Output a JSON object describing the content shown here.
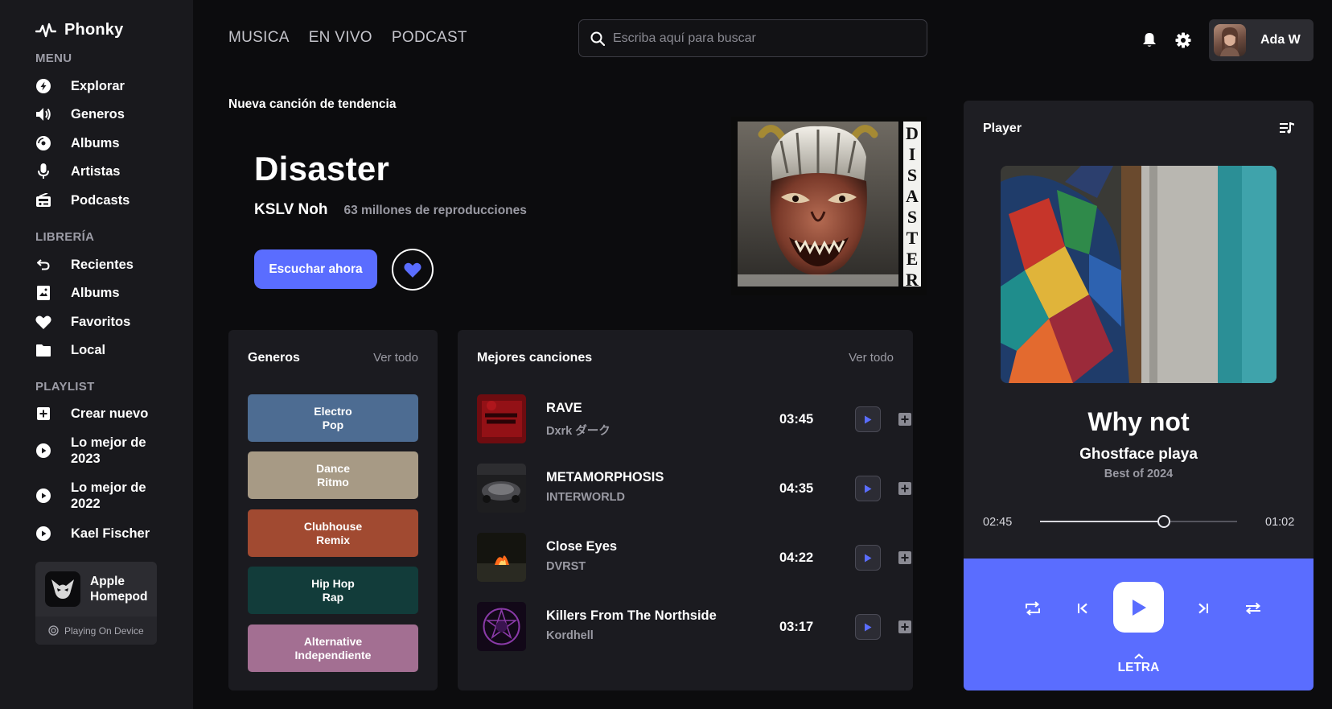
{
  "app": {
    "name": "Phonky"
  },
  "sidebar": {
    "menu_label": "MENU",
    "menu": [
      {
        "label": "Explorar",
        "icon": "compass-icon"
      },
      {
        "label": "Generos",
        "icon": "speaker-icon"
      },
      {
        "label": "Albums",
        "icon": "disc-icon"
      },
      {
        "label": "Artistas",
        "icon": "microphone-icon"
      },
      {
        "label": "Podcasts",
        "icon": "radio-icon"
      }
    ],
    "library_label": "LIBRERÍA",
    "library": [
      {
        "label": "Recientes",
        "icon": "history-icon"
      },
      {
        "label": "Albums",
        "icon": "album-icon"
      },
      {
        "label": "Favoritos",
        "icon": "heart-icon"
      },
      {
        "label": "Local",
        "icon": "folder-icon"
      }
    ],
    "playlist_label": "PLAYLIST",
    "playlist": [
      {
        "label": "Crear nuevo",
        "icon": "plus-square-icon"
      },
      {
        "label": "Lo mejor de 2023",
        "icon": "play-circle-icon"
      },
      {
        "label": "Lo mejor de 2022",
        "icon": "play-circle-icon"
      },
      {
        "label": "Kael Fischer",
        "icon": "play-circle-icon"
      }
    ],
    "device": {
      "name": "Apple Homepod",
      "status": "Playing On Device"
    }
  },
  "topnav": {
    "tabs": [
      "MUSICA",
      "EN VIVO",
      "PODCAST"
    ]
  },
  "search": {
    "placeholder": "Escriba aquí para buscar",
    "value": ""
  },
  "user": {
    "name": "Ada W"
  },
  "hero": {
    "label": "Nueva canción de tendencia",
    "title": "Disaster",
    "artist": "KSLV Noh",
    "plays": "63 millones de reproducciones",
    "cta": "Escuchar ahora",
    "cover_text": "DISASTER"
  },
  "genres": {
    "title": "Generos",
    "link": "Ver todo",
    "items": [
      {
        "line1": "Electro",
        "line2": "Pop",
        "color": "#4d6c92"
      },
      {
        "line1": "Dance",
        "line2": "Ritmo",
        "color": "#a79a85"
      },
      {
        "line1": "Clubhouse",
        "line2": "Remix",
        "color": "#a14a31"
      },
      {
        "line1": "Hip Hop",
        "line2": "Rap",
        "color": "#123c3a"
      },
      {
        "line1": "Alternative",
        "line2": "Independiente",
        "color": "#a36f92"
      }
    ]
  },
  "top_songs": {
    "title": "Mejores canciones",
    "link": "Ver todo",
    "items": [
      {
        "title": "RAVE",
        "artist": "Dxrk ダーク",
        "duration": "03:45",
        "thumb": "#8a1016"
      },
      {
        "title": "METAMORPHOSIS",
        "artist": "INTERWORLD",
        "duration": "04:35",
        "thumb": "#3a3a3e"
      },
      {
        "title": "Close Eyes",
        "artist": "DVRST",
        "duration": "04:22",
        "thumb": "#1b1a16"
      },
      {
        "title": "Killers From The Northside",
        "artist": "Kordhell",
        "duration": "03:17",
        "thumb": "#2a1438"
      }
    ]
  },
  "player": {
    "title": "Player",
    "song": "Why not",
    "artist": "Ghostface playa",
    "album": "Best of 2024",
    "elapsed": "02:45",
    "remaining": "01:02",
    "progress": 0.63,
    "lyrics_label": "LETRA",
    "accent": "#5a6dff"
  }
}
